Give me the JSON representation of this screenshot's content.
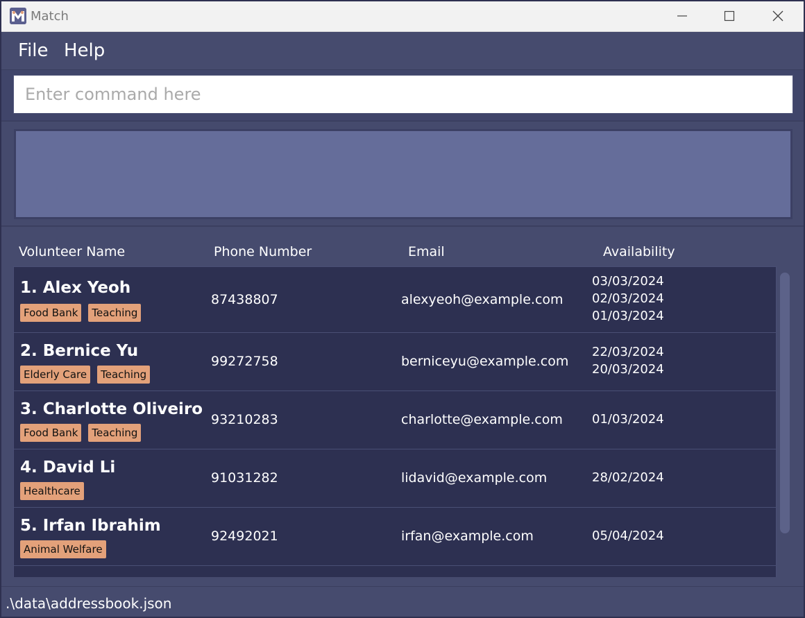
{
  "window": {
    "title": "Match",
    "icon": "app-logo-icon"
  },
  "menu": {
    "file_label": "File",
    "help_label": "Help"
  },
  "command": {
    "placeholder": "Enter command here",
    "value": ""
  },
  "result": {
    "text": ""
  },
  "headers": {
    "name": "Volunteer Name",
    "phone": "Phone Number",
    "email": "Email",
    "availability": "Availability"
  },
  "volunteers": [
    {
      "name": "1. Alex Yeoh",
      "tags": [
        "Food Bank",
        "Teaching"
      ],
      "phone": "87438807",
      "email": "alexyeoh@example.com",
      "availability": [
        "03/03/2024",
        "02/03/2024",
        "01/03/2024"
      ]
    },
    {
      "name": "2. Bernice Yu",
      "tags": [
        "Elderly Care",
        "Teaching"
      ],
      "phone": "99272758",
      "email": "berniceyu@example.com",
      "availability": [
        "22/03/2024",
        "20/03/2024"
      ]
    },
    {
      "name": "3. Charlotte Oliveiro",
      "tags": [
        "Food Bank",
        "Teaching"
      ],
      "phone": "93210283",
      "email": "charlotte@example.com",
      "availability": [
        "01/03/2024"
      ]
    },
    {
      "name": "4. David Li",
      "tags": [
        "Healthcare"
      ],
      "phone": "91031282",
      "email": "lidavid@example.com",
      "availability": [
        "28/02/2024"
      ]
    },
    {
      "name": "5. Irfan Ibrahim",
      "tags": [
        "Animal Welfare"
      ],
      "phone": "92492021",
      "email": "irfan@example.com",
      "availability": [
        "05/04/2024"
      ]
    }
  ],
  "status": {
    "path": ".\\data\\addressbook.json"
  },
  "colors": {
    "tag_bg": "#e3a17a",
    "card_bg": "#2d3051",
    "window_bg": "#464b6e",
    "result_bg": "#656d9a"
  }
}
